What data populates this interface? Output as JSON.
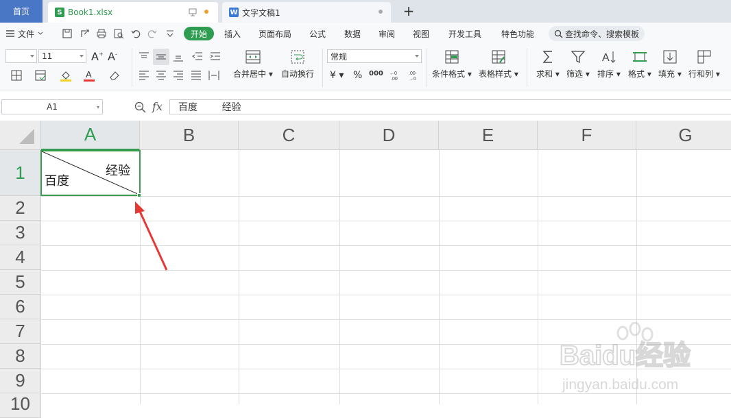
{
  "tabs": {
    "home": "首页",
    "doc1": {
      "label": "Book1.xlsx",
      "badge": "S"
    },
    "doc2": {
      "label": "文字文稿1",
      "badge": "W"
    },
    "new": "+"
  },
  "menu": {
    "file": "文件",
    "items": [
      "开始",
      "插入",
      "页面布局",
      "公式",
      "数据",
      "审阅",
      "视图",
      "开发工具",
      "特色功能"
    ],
    "search": "查找命令、搜索模板"
  },
  "ribbon": {
    "font_size": "11",
    "number_format": "常规",
    "merge_center": "合并居中",
    "wrap_text": "自动换行",
    "currency": "¥",
    "percent": "%",
    "thousands": "000",
    "conditional_format": "条件格式",
    "table_style": "表格样式",
    "sum": "求和",
    "filter": "筛选",
    "sort": "排序",
    "format": "格式",
    "fill": "填充",
    "rows_cols": "行和列"
  },
  "formula_bar": {
    "name_box": "A1",
    "fx": "fx",
    "content": "百度        经验"
  },
  "sheet": {
    "columns": [
      "A",
      "B",
      "C",
      "D",
      "E",
      "F",
      "G"
    ],
    "rows": [
      "1",
      "2",
      "3",
      "4",
      "5",
      "6",
      "7",
      "8",
      "9",
      "10"
    ],
    "selected_cell": "A1",
    "cell_a1_bottom_left": "百度",
    "cell_a1_top_right": "经验"
  },
  "watermark": {
    "brand": "Baidu经验",
    "url": "jingyan.baidu.com"
  },
  "colors": {
    "accent_green": "#2e9c51",
    "home_tab": "#4a76c6",
    "arrow": "#e53935"
  }
}
